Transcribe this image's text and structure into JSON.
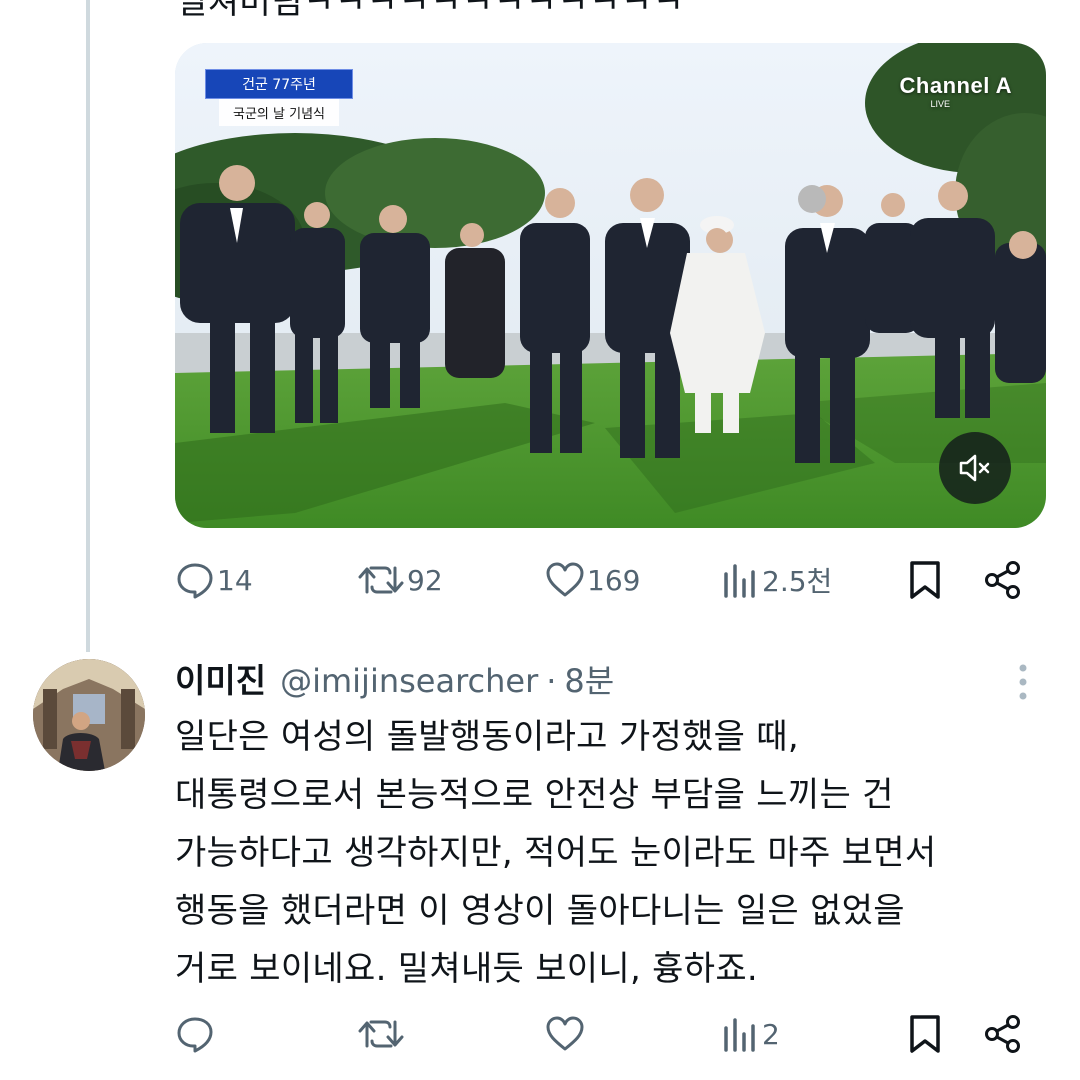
{
  "previous_tweet": {
    "cut_off_text": "밀쳐버림ㅋㅋㅋㅋㅋㅋㅋㅋㅋㅋㅋㅋ",
    "media": {
      "news_tag_line1": "건군 77주년",
      "news_tag_line2": "국군의 날 기념식",
      "channel_name": "Channel A",
      "channel_live": "LIVE",
      "mute_icon": "speaker-muted-icon"
    },
    "actions": {
      "replies": "14",
      "reposts": "92",
      "likes": "169",
      "views": "2.5천"
    }
  },
  "reply_tweet": {
    "display_name": "이미진",
    "handle": "@imijinsearcher",
    "separator": "·",
    "time": "8분",
    "body_lines": [
      "일단은 여성의 돌발행동이라고 가정했을 때,",
      "대통령으로서 본능적으로 안전상 부담을 느끼는 건",
      "가능하다고 생각하지만, 적어도 눈이라도 마주 보면서",
      "행동을 했더라면 이 영상이 돌아다니는 일은 없었을",
      "거로 보이네요. 밀쳐내듯 보이니, 흉하죠."
    ],
    "actions": {
      "replies": "",
      "reposts": "",
      "likes": "",
      "views": "2"
    }
  },
  "icons": {
    "reply": "reply-bubble-icon",
    "repost": "repost-arrows-icon",
    "like": "heart-icon",
    "views": "bar-chart-icon",
    "bookmark": "bookmark-icon",
    "share": "share-icon",
    "more": "more-vertical-icon"
  },
  "colors": {
    "text_primary": "#0f1419",
    "text_secondary": "#536471",
    "thread_line": "#cfd9de"
  }
}
